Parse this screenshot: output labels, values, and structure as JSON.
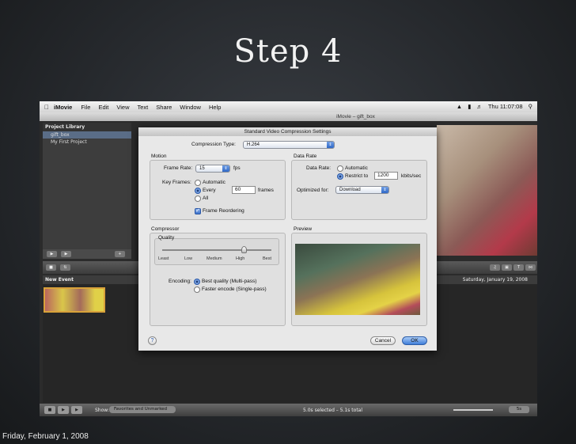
{
  "slide": {
    "title": "Step 4",
    "footer_date": "Friday, February 1, 2008"
  },
  "menubar": {
    "app_name": "iMovie",
    "items": [
      "File",
      "Edit",
      "View",
      "Text",
      "Share",
      "Window",
      "Help"
    ],
    "clock": "Thu 11:07:08"
  },
  "window": {
    "title": "iMovie – gift_box"
  },
  "library": {
    "header": "Project Library",
    "items": [
      "gift_box",
      "My First Project"
    ]
  },
  "events": {
    "header": "New Event",
    "date": "Saturday, January 19, 2008"
  },
  "bottombar": {
    "show_label": "Show:",
    "show_value": "Favorites and Unmarked",
    "status": "5.0s selected – 5.1s total",
    "zoom_value": "5s"
  },
  "dialog": {
    "title": "Standard Video Compression Settings",
    "compression_type_label": "Compression Type:",
    "compression_type_value": "H.264",
    "motion": {
      "title": "Motion",
      "frame_rate_label": "Frame Rate:",
      "frame_rate_value": "15",
      "fps_label": "fps",
      "key_frames_label": "Key Frames:",
      "kf_automatic": "Automatic",
      "kf_every": "Every",
      "kf_every_value": "60",
      "kf_frames": "frames",
      "kf_all": "All",
      "frame_reordering": "Frame Reordering"
    },
    "data_rate": {
      "title": "Data Rate",
      "data_rate_label": "Data Rate:",
      "automatic": "Automatic",
      "restrict_to": "Restrict to",
      "restrict_value": "1200",
      "unit": "kbits/sec",
      "optimized_label": "Optimized for:",
      "optimized_value": "Download"
    },
    "compressor": {
      "title": "Compressor",
      "quality_title": "Quality",
      "quality_level": 0.75,
      "ticks": [
        "Least",
        "Low",
        "Medium",
        "High",
        "Best"
      ],
      "encoding_label": "Encoding:",
      "enc_best": "Best quality (Multi-pass)",
      "enc_fast": "Faster encode (Single-pass)"
    },
    "preview": {
      "title": "Preview"
    },
    "help_label": "?",
    "cancel_label": "Cancel",
    "ok_label": "OK"
  },
  "colors": {
    "accent_blue": "#3f7ed9",
    "selection_gold": "#d9a23a"
  }
}
